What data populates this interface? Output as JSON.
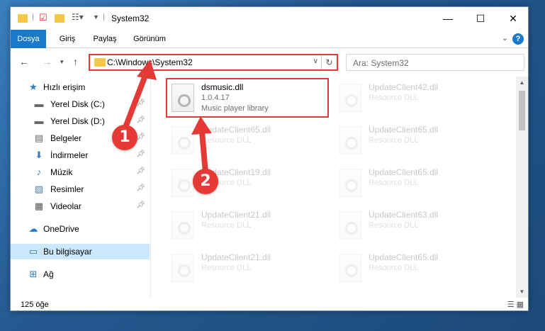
{
  "window": {
    "title": "System32",
    "controls": {
      "minimize": "—",
      "maximize": "☐",
      "close": "✕"
    }
  },
  "ribbon": {
    "tabs": [
      {
        "label": "Dosya"
      },
      {
        "label": "Giriş"
      },
      {
        "label": "Paylaş"
      },
      {
        "label": "Görünüm"
      }
    ],
    "help": "?"
  },
  "nav": {
    "address": "C:\\Windows\\System32",
    "search_placeholder": "Ara: System32"
  },
  "sidebar": {
    "items": [
      {
        "label": "Hızlı erişim",
        "icon": "star-icon"
      },
      {
        "label": "Yerel Disk (C:)",
        "icon": "drive-icon"
      },
      {
        "label": "Yerel Disk (D:)",
        "icon": "drive-icon"
      },
      {
        "label": "Belgeler",
        "icon": "document-icon"
      },
      {
        "label": "İndirmeler",
        "icon": "download-icon"
      },
      {
        "label": "Müzik",
        "icon": "music-icon"
      },
      {
        "label": "Resimler",
        "icon": "pictures-icon"
      },
      {
        "label": "Videolar",
        "icon": "video-icon"
      },
      {
        "label": "OneDrive",
        "icon": "cloud-icon"
      },
      {
        "label": "Bu bilgisayar",
        "icon": "computer-icon"
      },
      {
        "label": "Ağ",
        "icon": "network-icon"
      }
    ]
  },
  "files": [
    {
      "name": "dsmusic.dll",
      "version": "1.0.4.17",
      "desc": "Music player library"
    },
    {
      "name": "UpdateClient42.dll",
      "desc": "Resource DLL"
    },
    {
      "name": "UpdateClient65.dll",
      "desc": "Resource DLL"
    },
    {
      "name": "UpdateClient65.dll",
      "desc": "Resource DLL"
    },
    {
      "name": "UpdateClient19.dll",
      "desc": "Resource DLL"
    },
    {
      "name": "UpdateClient65.dll",
      "desc": "Resource DLL"
    },
    {
      "name": "UpdateClient21.dll",
      "desc": "Resource DLL"
    },
    {
      "name": "UpdateClient63.dll",
      "desc": "Resource DLL"
    },
    {
      "name": "UpdateClient21.dll",
      "desc": "Resource DLL"
    },
    {
      "name": "UpdateClient65.dll",
      "desc": "Resource DLL"
    }
  ],
  "status": {
    "count": "125 öğe"
  },
  "annotations": {
    "step1": "1",
    "step2": "2",
    "color": "#e53935"
  }
}
